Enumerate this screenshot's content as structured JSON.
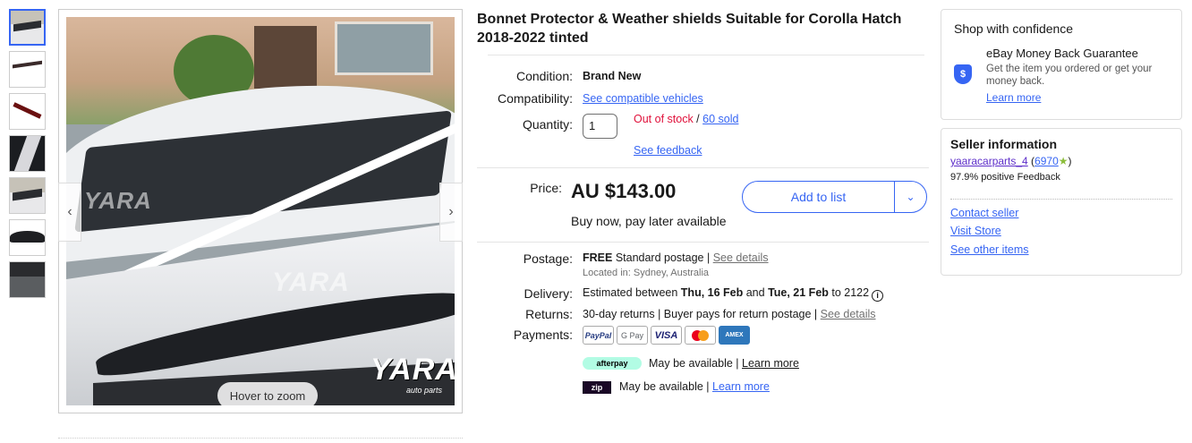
{
  "gallery": {
    "thumbnail_count": 7,
    "hover_hint": "Hover to zoom",
    "watermark": "YARA",
    "watermark_sub": "auto parts"
  },
  "listing": {
    "title": "Bonnet Protector & Weather shields Suitable for Corolla Hatch 2018-2022 tinted",
    "condition_label": "Condition:",
    "condition_value": "Brand New",
    "compat_label": "Compatibility:",
    "compat_link": "See compatible vehicles",
    "quantity_label": "Quantity:",
    "quantity_value": "1",
    "stock_status": "Out of stock",
    "stock_sep": " / ",
    "sold_count": "60 sold",
    "feedback_link": "See feedback",
    "price_label": "Price:",
    "price": "AU $143.00",
    "bnpl": "Buy now, pay later available",
    "add_to_list": "Add to list",
    "postage_label": "Postage:",
    "postage_free": "FREE",
    "postage_type": " Standard postage | ",
    "postage_details": "See details",
    "location": "Located in: Sydney, Australia",
    "delivery_label": "Delivery:",
    "delivery_pre": "Estimated between ",
    "delivery_from": "Thu, 16 Feb",
    "delivery_and": " and ",
    "delivery_to": "Tue, 21 Feb",
    "delivery_post": " to 2122",
    "returns_label": "Returns:",
    "returns_text": "30-day returns | Buyer pays for return postage | ",
    "returns_details": "See details",
    "payments_label": "Payments:",
    "payment_methods": [
      "PayPal",
      "G Pay",
      "VISA",
      "",
      "AMEX"
    ],
    "afterpay_label": "afterpay",
    "afterpay_text": "May be available | ",
    "afterpay_link": "Learn more",
    "zip_label": "zip",
    "zip_text": "May be available | ",
    "zip_link": "Learn more"
  },
  "confidence": {
    "title": "Shop with confidence",
    "mbg_title": "eBay Money Back Guarantee",
    "mbg_desc": "Get the item you ordered or get your money back.",
    "mbg_link": "Learn more"
  },
  "seller": {
    "title": "Seller information",
    "name": "yaaracarparts_4",
    "score": "6970",
    "feedback": "97.9% positive Feedback",
    "contact": "Contact seller",
    "store": "Visit Store",
    "other": "See other items"
  },
  "colors": {
    "link": "#3665f3",
    "oos": "#e0103a",
    "seller_name": "#5d2ec9"
  }
}
